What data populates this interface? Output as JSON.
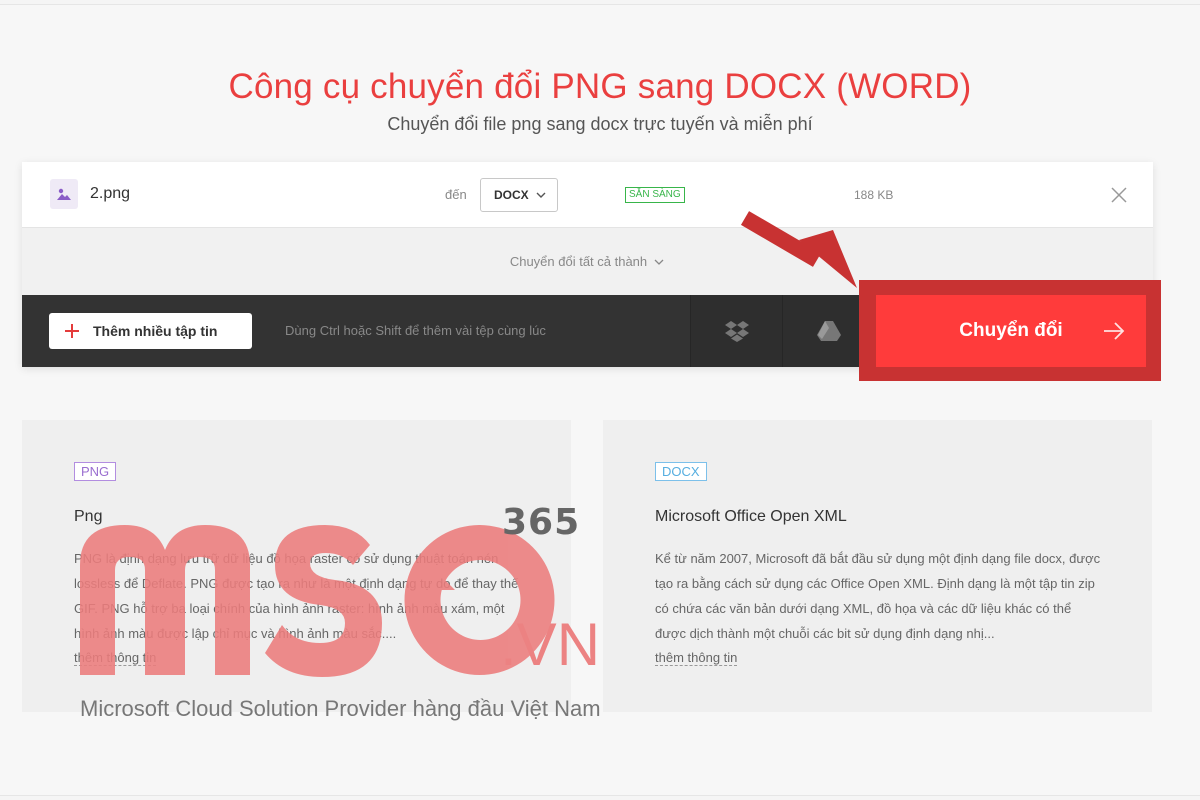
{
  "header": {
    "title": "Công cụ chuyển đổi PNG sang DOCX (WORD)",
    "subtitle": "Chuyển đổi file png sang docx trực tuyến và miễn phí"
  },
  "file": {
    "name": "2.png",
    "to_label": "đến",
    "format": "DOCX",
    "status": "SẴN SÀNG",
    "size": "188 KB",
    "icon": "image-file-icon"
  },
  "convert_all": {
    "label": "Chuyển đổi tất cả thành"
  },
  "toolbar": {
    "add_label": "Thêm nhiều tập tin",
    "hint": "Dùng Ctrl hoặc Shift để thêm vài tệp cùng lúc",
    "dropbox_icon": "dropbox-icon",
    "drive_icon": "google-drive-icon",
    "convert_label": "Chuyển đổi"
  },
  "info_left": {
    "tag": "PNG",
    "title": "Png",
    "text": "PNG là định dạng lưu trữ dữ liệu đồ họa raster có sử dụng thuật toán nén lossless để Deflate. PNG được tạo ra như là một định dạng tự do để thay thế GIF. PNG hỗ trợ ba loại chính của hình ảnh raster: hình ảnh màu xám, một hình ảnh màu được lập chỉ mục và hình ảnh màu sắc....",
    "more": "thêm thông tin"
  },
  "info_right": {
    "tag": "DOCX",
    "title": "Microsoft Office Open XML",
    "text": "Kể từ năm 2007, Microsoft đã bắt đầu sử dụng một định dạng file docx, được tạo ra bằng cách sử dụng các Office Open XML. Định dạng là một tập tin zip có chứa các văn bản dưới dạng XML, đồ họa và các dữ liệu khác có thể được dịch thành một chuỗi các bit sử dụng định dạng nhị...",
    "more": "thêm thông tin"
  },
  "watermark": {
    "brand": "mso",
    "number": "365",
    "domain": ".VN",
    "tagline": "Microsoft Cloud Solution Provider hàng đầu Việt Nam"
  },
  "colors": {
    "accent": "#ff3b3b",
    "title": "#ea3f3f",
    "status": "#38b54a",
    "highlight": "#c83232",
    "watermark": "#ec8282"
  }
}
